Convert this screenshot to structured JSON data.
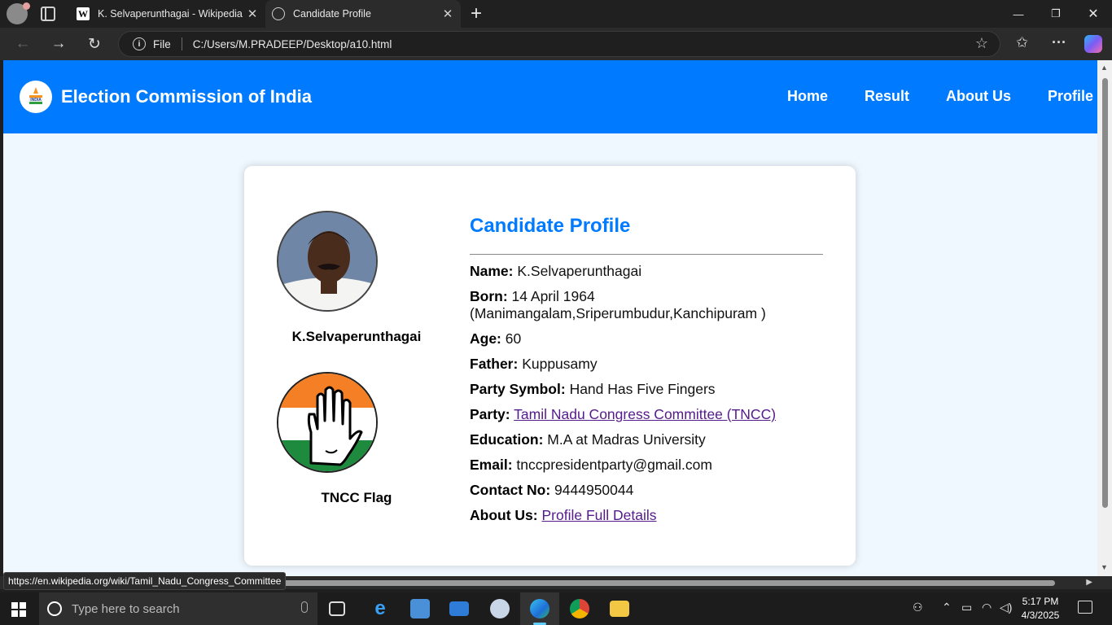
{
  "browser": {
    "tabs": [
      {
        "title": "K. Selvaperunthagai - Wikipedia",
        "favicon": "wikipedia-icon",
        "favicon_text": "W"
      },
      {
        "title": "Candidate Profile",
        "favicon": "globe-icon",
        "active": true
      }
    ],
    "address": {
      "scheme_label": "File",
      "url": "C:/Users/M.PRADEEP/Desktop/a10.html"
    },
    "status_url": "https://en.wikipedia.org/wiki/Tamil_Nadu_Congress_Committee"
  },
  "site": {
    "title": "Election Commission of India",
    "logo_text": "INDIA",
    "nav": [
      "Home",
      "Result",
      "About Us",
      "Profile"
    ],
    "brand_color": "#007bff"
  },
  "profile": {
    "heading": "Candidate Profile",
    "candidate_name": "K.Selvaperunthagai",
    "flag_caption": "TNCC Flag",
    "rows": [
      {
        "label": "Name:",
        "value": "K.Selvaperunthagai"
      },
      {
        "label": "Born:",
        "value": "14 April 1964 (Manimangalam,Sriperumbudur,Kanchipuram )"
      },
      {
        "label": "Age:",
        "value": "60"
      },
      {
        "label": "Father:",
        "value": "Kuppusamy"
      },
      {
        "label": "Party Symbol:",
        "value": "Hand Has Five Fingers"
      },
      {
        "label": "Party:",
        "link": "Tamil Nadu Congress Committee (TNCC)"
      },
      {
        "label": "Education:",
        "value": "M.A at Madras University"
      },
      {
        "label": "Email:",
        "value": "tnccpresidentparty@gmail.com"
      },
      {
        "label": "Contact No:",
        "value": "9444950044"
      },
      {
        "label": "About Us:",
        "link": "Profile Full Details"
      }
    ]
  },
  "taskbar": {
    "search_placeholder": "Type here to search",
    "time": "5:17 PM",
    "date": "4/3/2025"
  }
}
